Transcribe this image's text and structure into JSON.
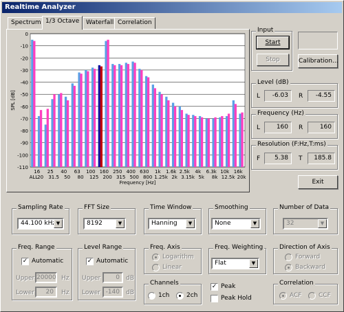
{
  "window": {
    "title": "Realtime Analyzer"
  },
  "tabs": [
    {
      "label": "Spectrum",
      "active": false
    },
    {
      "label": "1/3 Octave",
      "active": true
    },
    {
      "label": "Waterfall",
      "active": false
    },
    {
      "label": "Correlation",
      "active": false
    }
  ],
  "chart_data": {
    "type": "bar",
    "ylabel": "SPL [dB]",
    "xlabel": "Frequency [Hz]",
    "ylim": [
      -110,
      0
    ],
    "yticks": [
      0,
      -10,
      -20,
      -30,
      -40,
      -50,
      -60,
      -70,
      -80,
      -90,
      -100,
      -110
    ],
    "categories": [
      "ALL",
      "20",
      "25",
      "31.5",
      "40",
      "50",
      "63",
      "80",
      "100",
      "125",
      "160",
      "200",
      "250",
      "315",
      "400",
      "500",
      "630",
      "800",
      "1k",
      "1.25k",
      "1.6k",
      "2k",
      "2.5k",
      "3.15k",
      "4k",
      "5k",
      "6.3k",
      "8k",
      "10k",
      "12.5k",
      "16k",
      "20k"
    ],
    "tick_labels_top": [
      "16",
      "25",
      "40",
      "63",
      "100",
      "160",
      "250",
      "400",
      "630",
      "1k",
      "1.6k",
      "2.5k",
      "4k",
      "6.3k",
      "10k",
      "16k"
    ],
    "tick_labels_bottom": [
      "ALL",
      "20",
      "31.5",
      "50",
      "80",
      "125",
      "200",
      "315",
      "500",
      "800",
      "1.25k",
      "2k",
      "3.15k",
      "5k",
      "8k",
      "12.5k",
      "20k"
    ],
    "series": [
      {
        "name": "L",
        "color": "#5aa0e6",
        "values": [
          -5,
          -68,
          -75,
          -54,
          -50,
          -52,
          -41,
          -32,
          -30,
          -28,
          -26,
          -6,
          -25,
          -25,
          -24,
          -23,
          -29,
          -35,
          -42,
          -48,
          -52,
          -57,
          -60,
          -66,
          -67,
          -68,
          -70,
          -70,
          -69,
          -68,
          -55,
          -66
        ]
      },
      {
        "name": "R",
        "color": "#ff40c0",
        "values": [
          -6,
          -63,
          -62,
          -50,
          -49,
          -55,
          -43,
          -33,
          -31,
          -29,
          -27,
          -5,
          -26,
          -26,
          -25,
          -24,
          -30,
          -36,
          -45,
          -50,
          -55,
          -60,
          -63,
          -67,
          -68,
          -69,
          -70,
          -69,
          -68,
          -66,
          -58,
          -65
        ]
      }
    ],
    "highlight": {
      "category": "160",
      "colors": [
        "#1010a0",
        "#c00000"
      ]
    },
    "grid": true,
    "background": "#ffffff"
  },
  "input": {
    "label": "Input",
    "start": "Start",
    "stop": "Stop",
    "calibration": "Calibration..."
  },
  "level": {
    "label": "Level (dB)",
    "l_label": "L",
    "l_value": "-6.03",
    "r_label": "R",
    "r_value": "-4.55"
  },
  "frequency": {
    "label": "Frequency (Hz)",
    "l_label": "L",
    "l_value": "160",
    "r_label": "R",
    "r_value": "160"
  },
  "resolution": {
    "label": "Resolution (F:Hz,T:ms)",
    "f_label": "F",
    "f_value": "5.38",
    "t_label": "T",
    "t_value": "185.8"
  },
  "exit": "Exit",
  "sampling_rate": {
    "label": "Sampling Rate",
    "value": "44.100 kHz"
  },
  "fft_size": {
    "label": "FFT Size",
    "value": "8192"
  },
  "time_window": {
    "label": "Time Window",
    "value": "Hanning"
  },
  "smoothing": {
    "label": "Smoothing",
    "value": "None"
  },
  "number_of_data": {
    "label": "Number of Data",
    "value": "32"
  },
  "freq_range": {
    "label": "Freq. Range",
    "automatic": "Automatic",
    "upper_label": "Upper",
    "upper_value": "20000",
    "lower_label": "Lower",
    "lower_value": "20",
    "unit": "Hz"
  },
  "level_range": {
    "label": "Level Range",
    "automatic": "Automatic",
    "upper_label": "Upper",
    "upper_value": "0",
    "lower_label": "Lower",
    "lower_value": "-140",
    "unit": "dB"
  },
  "freq_axis": {
    "label": "Freq. Axis",
    "logarithm": "Logarithm",
    "linear": "Linear"
  },
  "freq_weighting": {
    "label": "Freq. Weighting",
    "value": "Flat"
  },
  "direction_of_axis": {
    "label": "Direction of Axis",
    "forward": "Forward",
    "backward": "Backward"
  },
  "channels": {
    "label": "Channels",
    "ch1": "1ch",
    "ch2": "2ch"
  },
  "peak": {
    "peak": "Peak",
    "peak_hold": "Peak Hold"
  },
  "correlation": {
    "label": "Correlation",
    "acf": "ACF",
    "ccf": "CCF"
  }
}
